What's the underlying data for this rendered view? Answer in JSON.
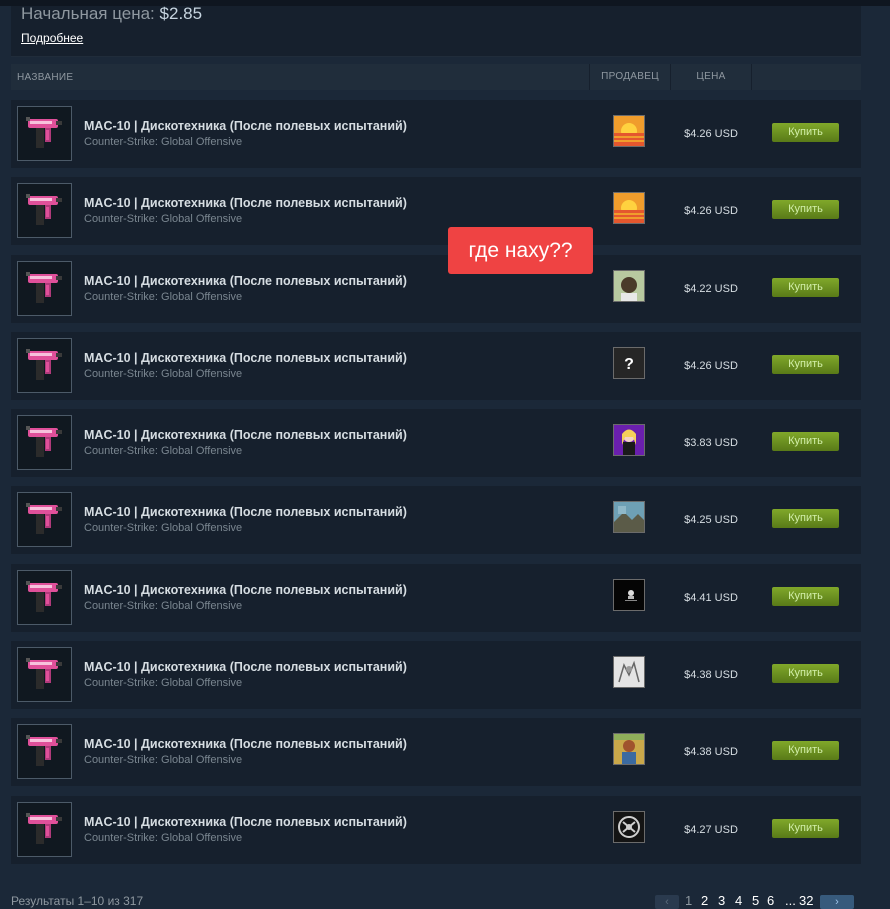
{
  "info": {
    "start_price_label": "Начальная цена:",
    "start_price_value": "$2.85",
    "more_link": "Подробнее"
  },
  "table": {
    "headers": {
      "name": "НАЗВАНИЕ",
      "seller": "ПРОДАВЕЦ",
      "price": "ЦЕНА"
    }
  },
  "rows": [
    {
      "name": "MAC-10 | Дискотехника (После полевых испытаний)",
      "game": "Counter-Strike: Global Offensive",
      "seller_avatar": "sunset-avatar",
      "price": "$4.26 USD",
      "buy": "Купить"
    },
    {
      "name": "MAC-10 | Дискотехника (После полевых испытаний)",
      "game": "Counter-Strike: Global Offensive",
      "seller_avatar": "sunset-avatar",
      "price": "$4.26 USD",
      "buy": "Купить"
    },
    {
      "name": "MAC-10 | Дискотехника (После полевых испытаний)",
      "game": "Counter-Strike: Global Offensive",
      "seller_avatar": "face-avatar",
      "price": "$4.22 USD",
      "buy": "Купить"
    },
    {
      "name": "MAC-10 | Дискотехника (После полевых испытаний)",
      "game": "Counter-Strike: Global Offensive",
      "seller_avatar": "question-avatar",
      "price": "$4.26 USD",
      "buy": "Купить"
    },
    {
      "name": "MAC-10 | Дискотехника (После полевых испытаний)",
      "game": "Counter-Strike: Global Offensive",
      "seller_avatar": "anime-avatar",
      "price": "$3.83 USD",
      "buy": "Купить"
    },
    {
      "name": "MAC-10 | Дискотехника (После полевых испытаний)",
      "game": "Counter-Strike: Global Offensive",
      "seller_avatar": "landscape-avatar",
      "price": "$4.25 USD",
      "buy": "Купить"
    },
    {
      "name": "MAC-10 | Дискотехника (После полевых испытаний)",
      "game": "Counter-Strike: Global Offensive",
      "seller_avatar": "dark-avatar",
      "price": "$4.41 USD",
      "buy": "Купить"
    },
    {
      "name": "MAC-10 | Дискотехника (После полевых испытаний)",
      "game": "Counter-Strike: Global Offensive",
      "seller_avatar": "sketch-avatar",
      "price": "$4.38 USD",
      "buy": "Купить"
    },
    {
      "name": "MAC-10 | Дискотехника (После полевых испытаний)",
      "game": "Counter-Strike: Global Offensive",
      "seller_avatar": "photo-avatar",
      "price": "$4.38 USD",
      "buy": "Купить"
    },
    {
      "name": "MAC-10 | Дискотехника (После полевых испытаний)",
      "game": "Counter-Strike: Global Offensive",
      "seller_avatar": "emblem-avatar",
      "price": "$4.27 USD",
      "buy": "Купить"
    }
  ],
  "overlay": {
    "text": "где наху??"
  },
  "footer": {
    "results": "Результаты 1–10 из 317",
    "pages": [
      "1",
      "2",
      "3",
      "4",
      "5",
      "6",
      "...",
      "32"
    ],
    "prev_icon": "chevron-left-icon",
    "next_icon": "chevron-right-icon"
  },
  "colors": {
    "background": "#1b2838",
    "row": "#16202d",
    "buy_button": "#80a82a",
    "overlay": "#ef4343"
  }
}
